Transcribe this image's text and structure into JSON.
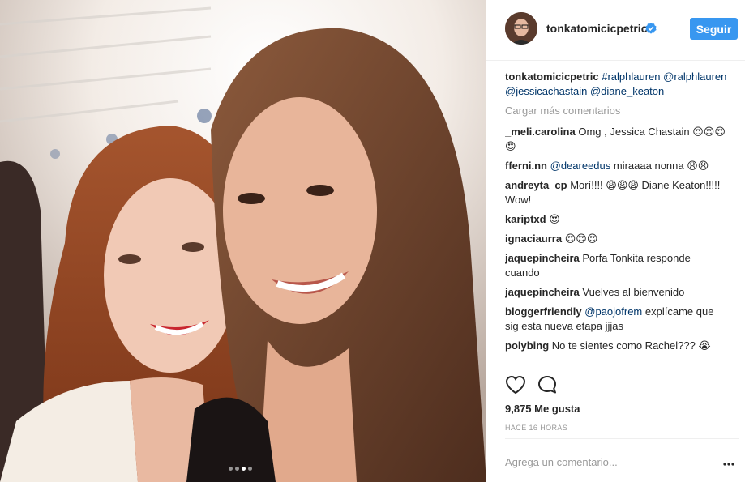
{
  "post": {
    "username": "tonkatomicicpetric",
    "follow_label": "Seguir",
    "caption_user": "tonkatomicicpetric",
    "caption_hashtag": "#ralphlauren",
    "caption_mention_1": "@ralphlauren",
    "caption_mention_2": "@jessicachastain",
    "caption_mention_3": "@diane_keaton",
    "load_more": "Cargar más comentarios",
    "likes": "9,875 Me gusta",
    "time": "HACE 16 HORAS",
    "comment_placeholder": "Agrega un comentario...",
    "more_label": "•••"
  },
  "comments": [
    {
      "user": "_meli.carolina",
      "mention": "",
      "text": "Omg , Jessica Chastain 😍😍😍😍"
    },
    {
      "user": "fferni.nn",
      "mention": "@deareedus",
      "text": "miraaaa nonna 😩😩"
    },
    {
      "user": "andreyta_cp",
      "mention": "",
      "text": "Morí!!!! 😩😩😩 Diane Keaton!!!!! Wow!"
    },
    {
      "user": "kariptxd",
      "mention": "",
      "text": "😍"
    },
    {
      "user": "ignaciaurra",
      "mention": "",
      "text": "😍😍😍"
    },
    {
      "user": "jaquepincheira",
      "mention": "",
      "text": "Porfa Tonkita responde cuando"
    },
    {
      "user": "jaquepincheira",
      "mention": "",
      "text": "Vuelves al bienvenido"
    },
    {
      "user": "bloggerfriendly",
      "mention": "@paojofrem",
      "text": "explícame que sig esta nueva etapa jjjas"
    },
    {
      "user": "polybing",
      "mention": "",
      "text": "No te sientes como Rachel??? 😭"
    }
  ],
  "colors": {
    "follow_bg": "#3897f0",
    "mention": "#003569",
    "muted": "#999999",
    "verified": "#3897f0"
  },
  "icons": [
    "heart-icon",
    "comment-icon",
    "verified-badge-icon",
    "more-options-icon"
  ]
}
